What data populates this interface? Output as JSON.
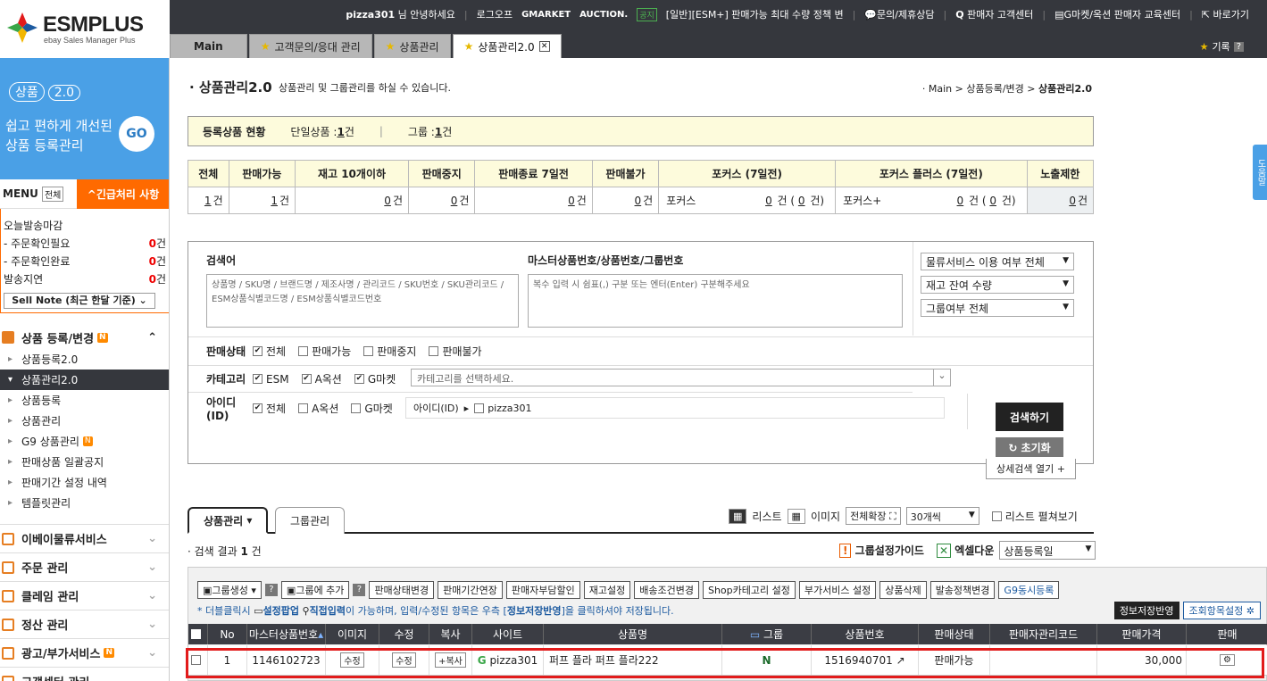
{
  "logo": {
    "name": "ESMPLUS",
    "sub": "ebay Sales Manager Plus"
  },
  "top": {
    "user": "pizza301",
    "greeting": "님 안녕하세요",
    "logout": "로그오프",
    "gmarket": "GMARKET",
    "auction": "AUCTION.",
    "notice_badge": "공지",
    "notice": "[일반][ESM+] 판매가능 최대 수량 정책 변",
    "inquiry": "문의/제휴상담",
    "seller_center": "판매자 고객센터",
    "edu": "G마켓/옥션 판매자 교육센터",
    "shortcut": "바로가기"
  },
  "tabs": [
    {
      "label": "Main"
    },
    {
      "label": "고객문의/응대 관리"
    },
    {
      "label": "상품관리"
    },
    {
      "label": "상품관리2.0"
    }
  ],
  "history": {
    "label": "기록",
    "q": "?"
  },
  "promo": {
    "title": "상품",
    "version": "2.0",
    "line1": "쉽고 편하게 개선된",
    "line2": "상품 등록관리",
    "go": "GO"
  },
  "menu": {
    "title": "MENU",
    "all": "전체",
    "urgent": "긴급처리 사항"
  },
  "todo": [
    {
      "label": "오늘발송마감",
      "value": ""
    },
    {
      "label": "- 주문확인필요",
      "value": "0",
      "unit": "건"
    },
    {
      "label": "- 주문확인완료",
      "value": "0",
      "unit": "건"
    },
    {
      "label": "발송지연",
      "value": "0",
      "unit": "건"
    }
  ],
  "sellnote": "Sell Note (최근 한달 기준) ⌄",
  "menu_main": {
    "group": "상품 등록/변경",
    "items": [
      "상품등록2.0",
      "상품관리2.0",
      "상품등록",
      "상품관리",
      "G9 상품관리",
      "판매상품 일괄공지",
      "판매기간 설정 내역",
      "템플릿관리"
    ]
  },
  "menu_groups": [
    "이베이물류서비스",
    "주문 관리",
    "클레임 관리",
    "정산 관리",
    "광고/부가서비스",
    "고객센터 관리"
  ],
  "page": {
    "title": "상품관리2.0",
    "desc": "상품관리 및 그룹관리를 하실 수 있습니다.",
    "bread1": "Main",
    "bread2": "상품등록/변경",
    "bread3": "상품관리2.0"
  },
  "summary": {
    "label": "등록상품 현황",
    "single_label": "단일상품 :",
    "single": "1",
    "group_label": "그룹 :",
    "group": "1",
    "unit": "건"
  },
  "stat_headers": [
    "전체",
    "판매가능",
    "재고 10개이하",
    "판매중지",
    "판매종료 7일전",
    "판매불가",
    "포커스 (7일전)",
    "포커스 플러스 (7일전)",
    "노출제한"
  ],
  "stat_values": [
    "1",
    "1",
    "0",
    "0",
    "0",
    "0",
    "0",
    "0",
    "0"
  ],
  "stat_focus": {
    "label": "포커스",
    "sub": "0",
    "label2": "포커스+",
    "sub2": "0"
  },
  "search": {
    "kw_label": "검색어",
    "kw_ph": "상품명 / SKU명 / 브랜드명 / 제조사명 / 관리코드 / SKU번호 / SKU관리코드 / ESM상품식별코드명 / ESM상품식별코드번호",
    "no_label": "마스터상품번호/상품번호/그룹번호",
    "no_ph": "복수 입력 시 쉼표(,) 구분 또는 엔터(Enter) 구분해주세요",
    "sel1": "물류서비스 이용 여부 전체",
    "sel2": "재고 잔여 수량",
    "sel3": "그룹여부 전체",
    "status_label": "판매상태",
    "status_opts": [
      "전체",
      "판매가능",
      "판매중지",
      "판매불가"
    ],
    "cat_label": "카테고리",
    "cat_opts": [
      "ESM",
      "A옥션",
      "G마켓"
    ],
    "cat_ph": "카테고리를 선택하세요.",
    "id_label": "아이디(ID)",
    "id_opts": [
      "전체",
      "A옥션",
      "G마켓"
    ],
    "id_box": "아이디(ID)",
    "id_val": "pizza301",
    "btn_search": "검색하기",
    "btn_reset": "↻ 초기화",
    "btn_detail": "상세검색 열기 +"
  },
  "list": {
    "tab1": "상품관리",
    "tab2": "그룹관리",
    "view_list": "리스트",
    "view_img": "이미지",
    "expand": "전체확장",
    "per": "30개씩",
    "flat": "리스트 펼쳐보기",
    "result": "· 검색 결과",
    "count": "1",
    "unit": "건",
    "guide": "그룹설정가이드",
    "excel": "엑셀다운",
    "sort": "상품등록일"
  },
  "buttons": [
    "그룹생성",
    "그룹에 추가",
    "판매상태변경",
    "판매기간연장",
    "판매자부담할인",
    "재고설정",
    "배송조건변경",
    "Shop카테고리 설정",
    "부가서비스 설정",
    "상품삭제",
    "발송정책변경",
    "G9동시등록"
  ],
  "hint": {
    "a": "* 더블클릭시",
    "b": "설정팝업",
    "c": "직접입력",
    "d": "이 가능하며, 입력/수정된 항목은 우측 [",
    "e": "정보저장반영",
    "f": "]을 클릭하셔야 저장됩니다."
  },
  "info_btns": {
    "save": "정보저장반영",
    "cols": "조회항목설정"
  },
  "columns": [
    "No",
    "마스터상품번호",
    "이미지",
    "수정",
    "복사",
    "사이트",
    "상품명",
    "그룹",
    "상품번호",
    "판매상태",
    "판매자관리코드",
    "판매가격",
    "판매"
  ],
  "row": {
    "no": "1",
    "master": "1146102723",
    "image": "수정",
    "edit": "수정",
    "copy": "복사",
    "site": "pizza301",
    "name": "퍼프 플라 퍼프 플라222",
    "group": "N",
    "product_no": "1516940701",
    "status": "판매가능",
    "code": "",
    "price": "30,000"
  },
  "feedback": "도움말"
}
